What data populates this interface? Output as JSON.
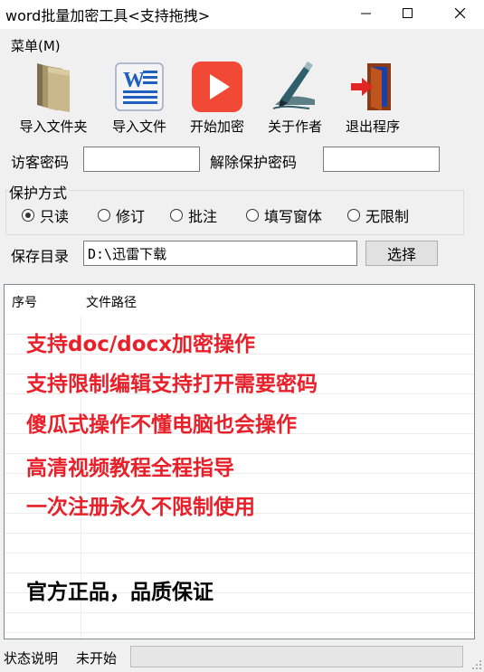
{
  "window": {
    "title": "word批量加密工具<支持拖拽>"
  },
  "menu": {
    "items": [
      "菜单(M)"
    ]
  },
  "toolbar": {
    "buttons": [
      {
        "label": "导入文件夹",
        "icon": "folder-icon"
      },
      {
        "label": "导入文件",
        "icon": "word-document-icon"
      },
      {
        "label": "开始加密",
        "icon": "play-icon"
      },
      {
        "label": "关于作者",
        "icon": "pen-writing-icon"
      },
      {
        "label": "退出程序",
        "icon": "exit-door-icon"
      }
    ]
  },
  "passwords": {
    "visitor_label": "访客密码",
    "visitor_value": "",
    "unprotect_label": "解除保护密码",
    "unprotect_value": ""
  },
  "protection": {
    "group_label": "保护方式",
    "options": [
      "只读",
      "修订",
      "批注",
      "填写窗体",
      "无限制"
    ],
    "selected": "只读"
  },
  "save": {
    "label": "保存目录",
    "path": "D:\\迅雷下载",
    "browse_label": "选择"
  },
  "file_list": {
    "columns": [
      "序号",
      "文件路径"
    ],
    "rows": []
  },
  "promo": {
    "lines": [
      "支持doc/docx加密操作",
      "支持限制编辑支持打开需要密码",
      "傻瓜式操作不懂电脑也会操作",
      "高清视频教程全程指导",
      "一次注册永久不限制使用"
    ],
    "footer": "官方正品，品质保证",
    "color": "#e8202a"
  },
  "status": {
    "label": "状态说明",
    "value": "未开始",
    "progress": 0
  }
}
